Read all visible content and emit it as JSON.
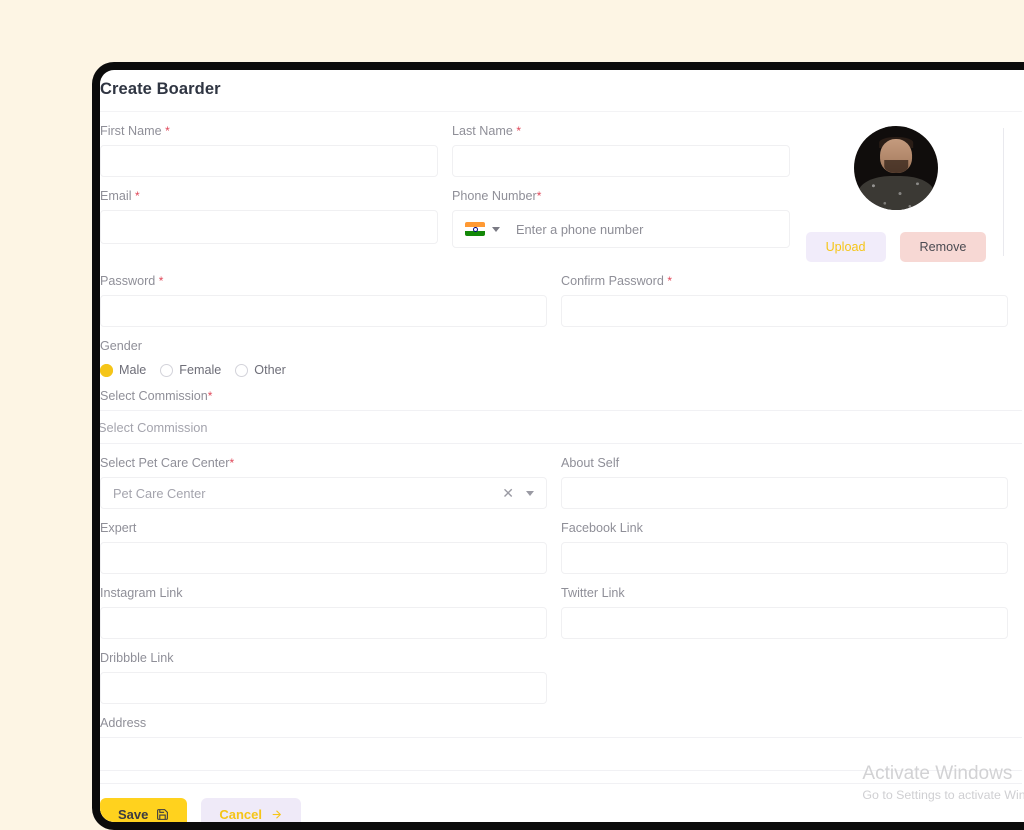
{
  "page": {
    "title": "Create Boarder",
    "background_color": "#fdf5e4",
    "accent_color": "#f5c518",
    "required_marker_color": "#e0485a"
  },
  "form": {
    "first_name": {
      "label": "First Name",
      "required": true,
      "value": "",
      "placeholder": ""
    },
    "last_name": {
      "label": "Last Name",
      "required": true,
      "value": "",
      "placeholder": ""
    },
    "email": {
      "label": "Email",
      "required": true,
      "value": "",
      "placeholder": ""
    },
    "phone": {
      "label": "Phone Number",
      "required": true,
      "value": "",
      "placeholder": "Enter a phone number",
      "country_flag": "india-flag-icon"
    },
    "password": {
      "label": "Password",
      "required": true,
      "value": "",
      "placeholder": ""
    },
    "confirm_password": {
      "label": "Confirm Password",
      "required": true,
      "value": "",
      "placeholder": ""
    },
    "gender": {
      "label": "Gender",
      "selected": "Male",
      "options": [
        "Male",
        "Female",
        "Other"
      ]
    },
    "commission": {
      "label": "Select Commission",
      "required": true,
      "value": "Select Commission"
    },
    "pet_care_center": {
      "label": "Select Pet Care Center",
      "required": true,
      "value": "Pet Care Center"
    },
    "about_self": {
      "label": "About Self",
      "required": false,
      "value": "",
      "placeholder": ""
    },
    "expert": {
      "label": "Expert",
      "required": false,
      "value": "",
      "placeholder": ""
    },
    "facebook_link": {
      "label": "Facebook Link",
      "required": false,
      "value": "",
      "placeholder": ""
    },
    "instagram_link": {
      "label": "Instagram Link",
      "required": false,
      "value": "",
      "placeholder": ""
    },
    "twitter_link": {
      "label": "Twitter Link",
      "required": false,
      "value": "",
      "placeholder": ""
    },
    "dribbble_link": {
      "label": "Dribbble Link",
      "required": false,
      "value": "",
      "placeholder": ""
    },
    "address": {
      "label": "Address",
      "required": false,
      "value": "",
      "placeholder": ""
    }
  },
  "avatar": {
    "upload_label": "Upload",
    "remove_label": "Remove",
    "upload_bg": "#f1ecfa",
    "upload_text_color": "#f5c518",
    "remove_bg": "#f7d8d4",
    "remove_text_color": "#4b4b52"
  },
  "footer": {
    "save_label": "Save",
    "cancel_label": "Cancel",
    "save_bg": "#ffd21e",
    "cancel_bg": "#efeaf8"
  },
  "watermark": {
    "title": "Activate Windows",
    "subtitle": "Go to Settings to activate Windows."
  }
}
